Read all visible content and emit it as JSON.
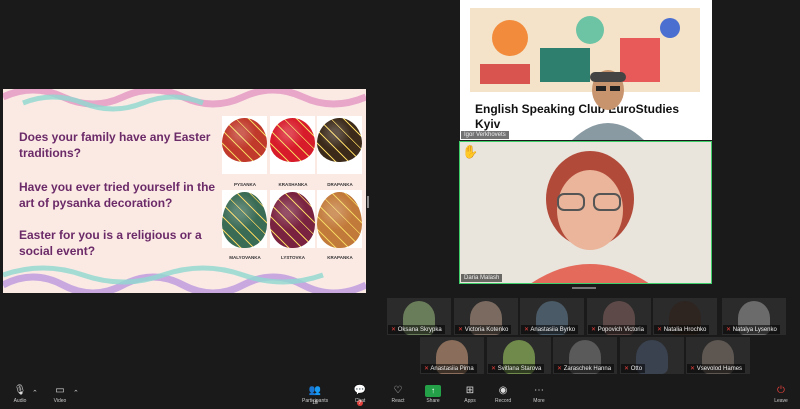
{
  "slide": {
    "questions": [
      "Does your family have any Easter traditions?",
      "Have you ever tried yourself in the art of pysanka decoration?",
      "Easter for you is a religious or a social event?"
    ],
    "eggs": [
      {
        "label": "PYSANKA",
        "color": "#c0392b"
      },
      {
        "label": "KRASHANKA",
        "color": "#d81b2b"
      },
      {
        "label": "DRAPANKA",
        "color": "#3b2a1a"
      },
      {
        "label": "MALYOVANKA",
        "color": "#3a6b55"
      },
      {
        "label": "LYSTOVKA",
        "color": "#7a2340"
      },
      {
        "label": "KRAPANKA",
        "color": "#c27a3a"
      }
    ]
  },
  "share_tile": {
    "title": "English Speaking Club EuroStudies Kyiv",
    "name": "Igor Verkhovets"
  },
  "speaker_tile": {
    "name": "Daria Malash",
    "hand_icon": "raised-hand-icon"
  },
  "participants": [
    {
      "name": "Oksana Skrypka",
      "color": "#6a7d5a"
    },
    {
      "name": "Victoria Kotenko",
      "color": "#7b6a60"
    },
    {
      "name": "Anastasiia Byrko",
      "color": "#4a5a66"
    },
    {
      "name": "Popovich Victoria",
      "color": "#5d4a48"
    },
    {
      "name": "Natalia Hrochko",
      "color": "#2e2420"
    },
    {
      "name": "Natalya Lysenko",
      "color": "#6b6b6b"
    },
    {
      "name": "Anastasiia Pirna",
      "color": "#8a6d5a"
    },
    {
      "name": "Svitlana Starova",
      "color": "#6f8a4a"
    },
    {
      "name": "Zaraschek Hanna",
      "color": "#5a5a5a"
    },
    {
      "name": "Otto",
      "color": "#3a4250"
    },
    {
      "name": "Vsevolod Hames",
      "color": "#5e5650"
    }
  ],
  "toolbar": {
    "audio": "Audio",
    "video": "Video",
    "participants": "Participants",
    "participants_count": "18",
    "chat": "Chat",
    "chat_badge": "7",
    "react": "React",
    "share": "Share",
    "apps": "Apps",
    "record": "Record",
    "more": "More",
    "leave": "Leave"
  },
  "colors": {
    "accent_green": "#3ecf6a",
    "slide_text": "#6b2a68",
    "mic_muted": "#e2403c"
  }
}
